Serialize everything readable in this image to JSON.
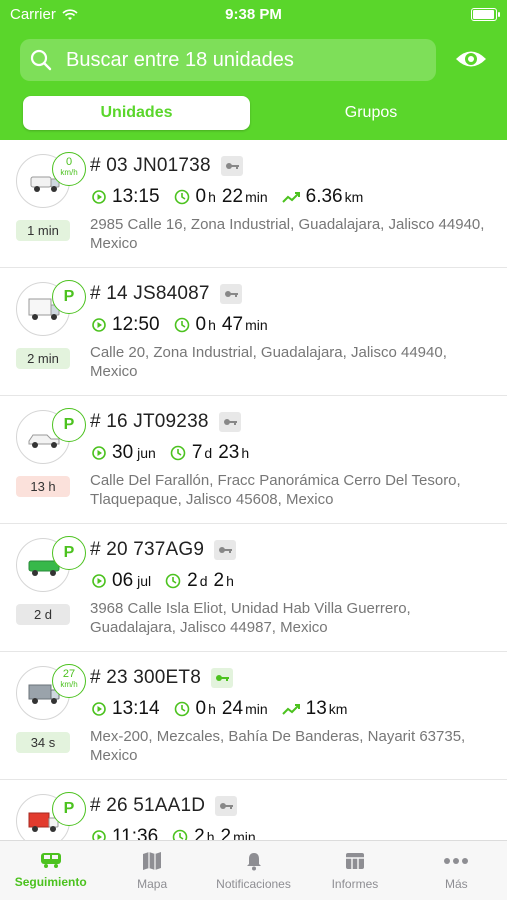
{
  "status": {
    "carrier": "Carrier",
    "time": "9:38 PM",
    "battery_level": 0.95
  },
  "header": {
    "search_placeholder": "Buscar entre 18 unidades",
    "segments": {
      "active": "Unidades",
      "inactive": "Grupos"
    },
    "accent": "#5ad62b"
  },
  "units": [
    {
      "title": "# 03 JN01738",
      "badge_speed": "0",
      "badge_unit": "km/h",
      "time_ago": "1 min",
      "stat1_main": "13:15",
      "stat2_main": "0",
      "stat2_unit": "h",
      "stat2_rest": "22",
      "stat2_unit2": "min",
      "stat3_main": "6.36",
      "stat3_unit": "km",
      "address": "2985 Calle 16, Zona Industrial, Guadalajara, Jalisco 44940, Mexico",
      "vehicle_icon": "truck-white-icon"
    },
    {
      "title": "# 14 JS84087",
      "badge_text": "P",
      "time_ago": "2 min",
      "stat1_main": "12:50",
      "stat2_main": "0",
      "stat2_unit": "h",
      "stat2_rest": "47",
      "stat2_unit2": "min",
      "address": "Calle 20, Zona Industrial, Guadalajara, Jalisco 44940, Mexico",
      "vehicle_icon": "box-truck-icon"
    },
    {
      "title": "# 16 JT09238",
      "badge_text": "P",
      "time_ago": "13 h",
      "stat1_main": "30",
      "stat1_unit": "jun",
      "stat2_main": "7",
      "stat2_unit": "d",
      "stat2_rest": "23",
      "stat2_unit2": "h",
      "address": "Calle Del Farallón, Fracc Panorámica Cerro Del Tesoro, Tlaquepaque, Jalisco 45608, Mexico",
      "vehicle_icon": "pickup-icon"
    },
    {
      "title": "# 20 737AG9",
      "badge_text": "P",
      "time_ago": "2 d",
      "stat1_main": "06",
      "stat1_unit": "jul",
      "stat2_main": "2",
      "stat2_unit": "d",
      "stat2_rest": "2",
      "stat2_unit2": "h",
      "address": "3968 Calle Isla Eliot, Unidad Hab Villa Guerrero, Guadalajara, Jalisco 44987, Mexico",
      "vehicle_icon": "green-truck-icon"
    },
    {
      "title": "# 23 300ET8",
      "badge_speed": "27",
      "badge_unit": "km/h",
      "time_ago": "34 s",
      "stat1_main": "13:14",
      "stat2_main": "0",
      "stat2_unit": "h",
      "stat2_rest": "24",
      "stat2_unit2": "min",
      "stat3_main": "13",
      "stat3_unit": "km",
      "address": "Mex-200, Mezcales, Bahía De Banderas, Nayarit 63735, Mexico",
      "vehicle_icon": "cargo-truck-icon"
    },
    {
      "title": "# 26 51AA1D",
      "badge_text": "P",
      "stat1_main": "11:36",
      "stat2_main": "2",
      "stat2_unit": "h",
      "stat2_rest": "2",
      "stat2_unit2": "min",
      "vehicle_icon": "red-truck-icon"
    }
  ],
  "tabbar": {
    "tabs": [
      {
        "label": "Seguimiento"
      },
      {
        "label": "Mapa"
      },
      {
        "label": "Notificaciones"
      },
      {
        "label": "Informes"
      },
      {
        "label": "Más"
      }
    ]
  }
}
